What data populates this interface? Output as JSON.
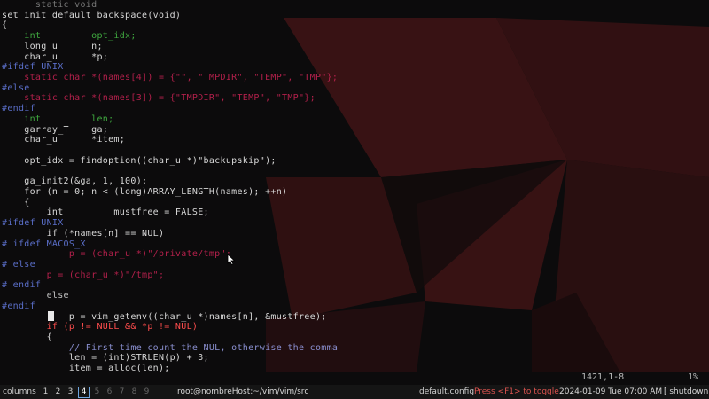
{
  "code_lines": [
    {
      "text": "      static void",
      "cls": "c-dim"
    },
    {
      "text": "set_init_default_backspace(void)",
      "cls": "c-def"
    },
    {
      "text": "{",
      "cls": "c-def"
    },
    {
      "text": "    int         opt_idx;",
      "cls": "c-type"
    },
    {
      "text": "    long_u      n;",
      "cls": "c-def"
    },
    {
      "text": "    char_u      *p;",
      "cls": "c-def"
    },
    {
      "text": "#ifdef UNIX",
      "cls": "c-pre"
    },
    {
      "text": "    static char *(names[4]) = {\"\", \"TMPDIR\", \"TEMP\", \"TMP\"};",
      "cls": "c-str"
    },
    {
      "text": "#else",
      "cls": "c-pre"
    },
    {
      "text": "    static char *(names[3]) = {\"TMPDIR\", \"TEMP\", \"TMP\"};",
      "cls": "c-str"
    },
    {
      "text": "#endif",
      "cls": "c-pre"
    },
    {
      "text": "    int         len;",
      "cls": "c-type"
    },
    {
      "text": "    garray_T    ga;",
      "cls": "c-def"
    },
    {
      "text": "    char_u      *item;",
      "cls": "c-def"
    },
    {
      "text": "",
      "cls": "c-def"
    },
    {
      "text": "    opt_idx = findoption((char_u *)\"backupskip\");",
      "cls": "c-def"
    },
    {
      "text": "",
      "cls": "c-def"
    },
    {
      "text": "    ga_init2(&ga, 1, 100);",
      "cls": "c-def"
    },
    {
      "text": "    for (n = 0; n < (long)ARRAY_LENGTH(names); ++n)",
      "cls": "c-def"
    },
    {
      "text": "    {",
      "cls": "c-def"
    },
    {
      "text": "        int         mustfree = FALSE;",
      "cls": "c-def"
    },
    {
      "text": "#ifdef UNIX",
      "cls": "c-pre"
    },
    {
      "text": "        if (*names[n] == NUL)",
      "cls": "c-def"
    },
    {
      "text": "# ifdef MACOS_X",
      "cls": "c-pre"
    },
    {
      "text": "            p = (char_u *)\"/private/tmp\";",
      "cls": "c-str"
    },
    {
      "text": "# else",
      "cls": "c-pre"
    },
    {
      "text": "        p = (char_u *)\"/tmp\";",
      "cls": "c-str"
    },
    {
      "text": "# endif",
      "cls": "c-pre"
    },
    {
      "text": "        else",
      "cls": "c-kw"
    },
    {
      "text": "#endif",
      "cls": "c-pre"
    },
    {
      "text": "            p = vim_getenv((char_u *)names[n], &mustfree);",
      "cls": "c-def"
    },
    {
      "text": "        if (p != NULL && *p != NUL)",
      "cls": "c-red"
    },
    {
      "text": "        {",
      "cls": "c-def"
    },
    {
      "text": "            // First time count the NUL, otherwise the comma",
      "cls": "c-com"
    },
    {
      "text": "            len = (int)STRLEN(p) + 3;",
      "cls": "c-def"
    },
    {
      "text": "            item = alloc(len);",
      "cls": "c-def"
    }
  ],
  "vim_status": {
    "ruler": "1421,1-8",
    "scroll": "1%"
  },
  "taskbar": {
    "layout_label": "columns",
    "workspaces": [
      {
        "label": "1",
        "state": "normal"
      },
      {
        "label": "2",
        "state": "normal"
      },
      {
        "label": "3",
        "state": "normal"
      },
      {
        "label": "4",
        "state": "active"
      },
      {
        "label": "5",
        "state": "dim"
      },
      {
        "label": "6",
        "state": "dim"
      },
      {
        "label": "7",
        "state": "dim"
      },
      {
        "label": "8",
        "state": "dim"
      },
      {
        "label": "9",
        "state": "dim"
      }
    ],
    "window_title": "root@nombreHost:~/vim/vim/src",
    "config_label": "default.config",
    "config_hint": "Press <F1> to toggle",
    "clock": "2024-01-09 Tue 07:00 AM",
    "shutdown_label": "[ shutdown ]"
  },
  "colors": {
    "wallpaper_red": "#7a1a1e",
    "terminal_bg": "#0b0b0c",
    "active_workspace_border": "#6fa6e0"
  },
  "icons": {
    "pointer": "arrow-cursor-icon"
  }
}
